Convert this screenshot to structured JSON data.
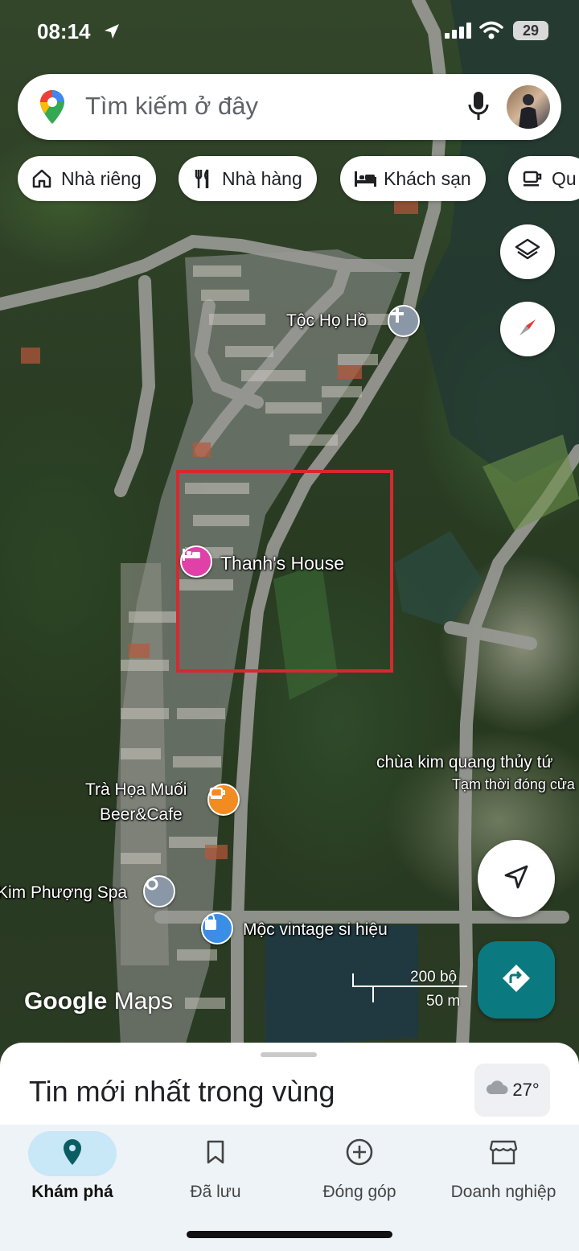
{
  "status_bar": {
    "time": "08:14",
    "battery": "29"
  },
  "search": {
    "placeholder": "Tìm kiếm ở đây"
  },
  "chips": [
    {
      "label": "Nhà riêng",
      "icon": "home-icon"
    },
    {
      "label": "Nhà hàng",
      "icon": "restaurant-icon"
    },
    {
      "label": "Khách sạn",
      "icon": "hotel-icon"
    },
    {
      "label": "Qu",
      "icon": "coffee-icon"
    }
  ],
  "map": {
    "places": [
      {
        "name": "Tộc Họ Hồ",
        "icon": "church-icon"
      },
      {
        "name": "Thanh's House",
        "icon": "hotel-icon",
        "color": "#e040a8"
      },
      {
        "name": "chùa kim quang thủy tứ",
        "subtitle": "Tạm thời đóng cửa"
      },
      {
        "name_line1": "Trà Họa Muối",
        "name_line2": "Beer&Cafe",
        "icon": "cafe-icon",
        "color": "#f28b20"
      },
      {
        "name": "Kim Phượng Spa",
        "icon": "spa-icon",
        "color": "#8a97a6"
      },
      {
        "name": "Mộc vintage si hiệu",
        "icon": "shopping-bag-icon",
        "color": "#3a8ee6"
      }
    ],
    "highlight_color": "#d8282f",
    "logo_google": "Google",
    "logo_maps": "Maps",
    "scale": {
      "imperial": "200 bộ",
      "metric": "50 m"
    }
  },
  "sheet": {
    "title": "Tin mới nhất trong vùng",
    "temperature": "27°"
  },
  "nav": [
    {
      "label": "Khám phá",
      "icon": "explore-pin-icon",
      "active": true
    },
    {
      "label": "Đã lưu",
      "icon": "bookmark-icon",
      "active": false
    },
    {
      "label": "Đóng góp",
      "icon": "add-circle-icon",
      "active": false
    },
    {
      "label": "Doanh nghiệp",
      "icon": "storefront-icon",
      "active": false
    }
  ],
  "colors": {
    "accent": "#0b7a80",
    "nav_active_bg": "#c8e7f7"
  }
}
